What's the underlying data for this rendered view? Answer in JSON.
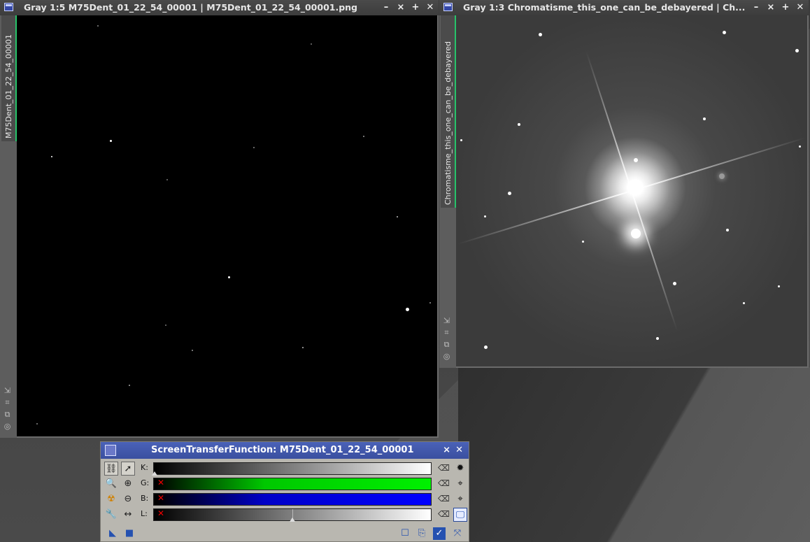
{
  "window_left": {
    "title": "Gray 1:5 M75Dent_01_22_54_00001 | M75Dent_01_22_54_00001.png",
    "tab_label": "M75Dent_01_22_54_00001",
    "buttons": [
      "−",
      "⨯",
      "+",
      "✕"
    ]
  },
  "window_right": {
    "title": "Gray 1:3 Chromatisme_this_one_can_be_debayered | Ch...",
    "tab_label": "Chromatisme_this_one_can_be_debayered",
    "buttons": [
      "−",
      "⨯",
      "+",
      "✕"
    ]
  },
  "stf": {
    "title": "ScreenTransferFunction: M75Dent_01_22_54_00001",
    "channels": [
      {
        "label": "K:",
        "type": "k",
        "disabled": false,
        "midtone": 0.0
      },
      {
        "label": "G:",
        "type": "g",
        "disabled": true,
        "midtone": 0.0
      },
      {
        "label": "B:",
        "type": "b",
        "disabled": true,
        "midtone": 0.0
      },
      {
        "label": "L:",
        "type": "l",
        "disabled": true,
        "midtone": 0.5
      }
    ]
  },
  "icons": {
    "link": "link-icon",
    "pointer": "pointer-icon",
    "zoom": "zoom-icon",
    "zoom_in": "zoom-in-icon",
    "zoom_out": "zoom-out-icon",
    "radiation": "auto-stretch-icon",
    "wrench": "wrench-icon",
    "arrows": "horizontal-arrows-icon",
    "reset": "reset-icon"
  }
}
